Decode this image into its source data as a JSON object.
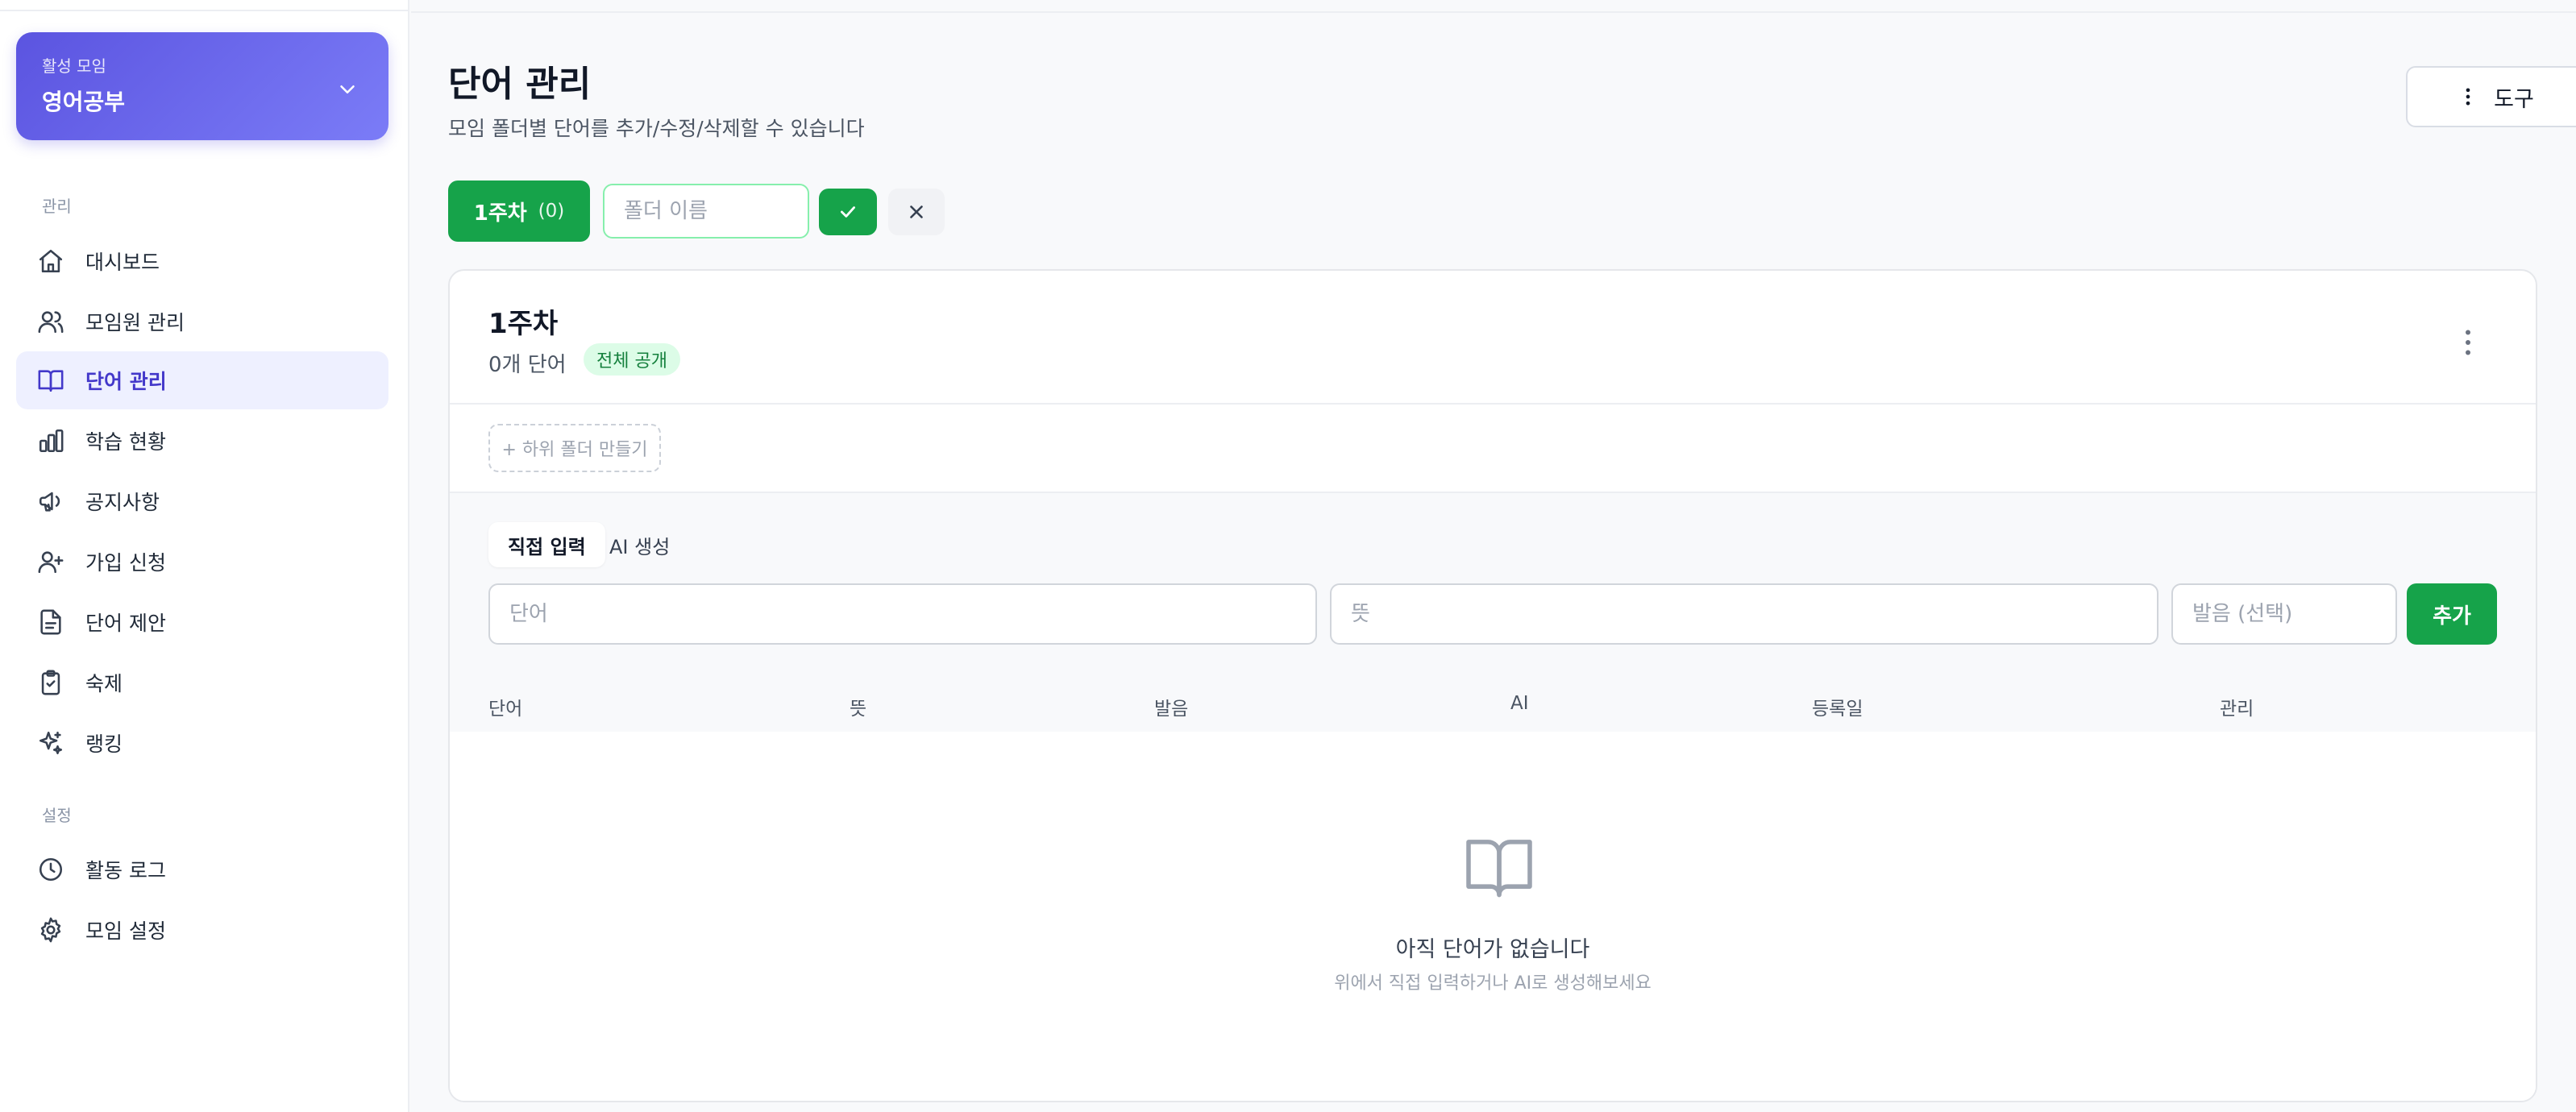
{
  "sidebar": {
    "group_caption": "활성 모임",
    "group_name": "영어공부",
    "section_manage": "관리",
    "section_settings": "설정",
    "items": [
      {
        "label": "대시보드",
        "icon": "home-icon"
      },
      {
        "label": "모임원 관리",
        "icon": "users-icon"
      },
      {
        "label": "단어 관리",
        "icon": "book-icon",
        "active": true
      },
      {
        "label": "학습 현황",
        "icon": "bar-chart-icon"
      },
      {
        "label": "공지사항",
        "icon": "megaphone-icon"
      },
      {
        "label": "가입 신청",
        "icon": "user-plus-icon"
      },
      {
        "label": "단어 제안",
        "icon": "document-icon"
      },
      {
        "label": "숙제",
        "icon": "clipboard-check-icon"
      },
      {
        "label": "랭킹",
        "icon": "sparkles-icon"
      }
    ],
    "settings_items": [
      {
        "label": "활동 로그",
        "icon": "clock-icon"
      },
      {
        "label": "모임 설정",
        "icon": "gear-icon"
      }
    ]
  },
  "header": {
    "title": "단어 관리",
    "subtitle": "모임 폴더별 단어를 추가/수정/삭제할 수 있습니다",
    "tools_label": "도구"
  },
  "folders": {
    "active_name": "1주차",
    "active_count": "(0)",
    "new_folder_placeholder": "폴더 이름"
  },
  "folder_card": {
    "title": "1주차",
    "word_count": "0개 단어",
    "visibility_badge": "전체 공개",
    "add_subfolder_label": "+ 하위 폴더 만들기"
  },
  "input_tabs": [
    "직접 입력",
    "AI 생성"
  ],
  "form": {
    "word_placeholder": "단어",
    "meaning_placeholder": "뜻",
    "pronunciation_placeholder": "발음 (선택)",
    "add_label": "추가"
  },
  "table": {
    "columns": [
      "단어",
      "뜻",
      "발음",
      "AI",
      "등록일",
      "관리"
    ],
    "rows": []
  },
  "empty_state": {
    "title": "아직 단어가 없습니다",
    "subtitle": "위에서 직접 입력하거나 AI로 생성해보세요"
  },
  "colors": {
    "primary_green": "#16a34a",
    "accent_indigo": "#5b54e0",
    "active_nav_bg": "#eef0ff"
  }
}
